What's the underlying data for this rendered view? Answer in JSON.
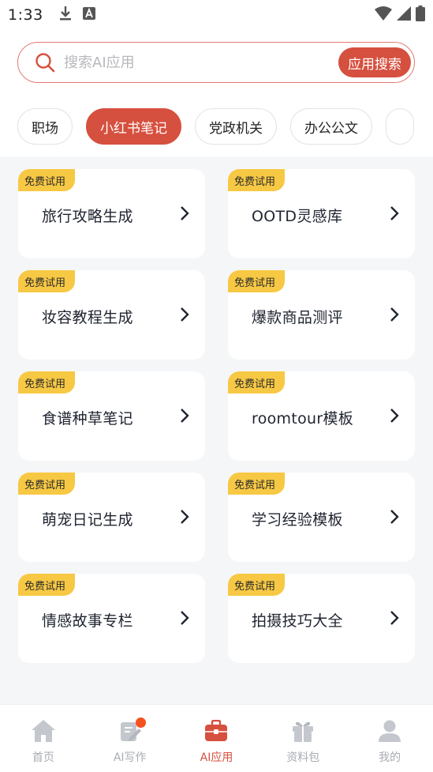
{
  "status_bar": {
    "time": "1:33"
  },
  "search": {
    "placeholder": "搜索AI应用",
    "button_label": "应用搜索"
  },
  "categories": [
    {
      "label": "职场",
      "active": false
    },
    {
      "label": "小红书笔记",
      "active": true
    },
    {
      "label": "党政机关",
      "active": false
    },
    {
      "label": "办公公文",
      "active": false
    }
  ],
  "cards": [
    {
      "badge": "免费试用",
      "title": "旅行攻略生成"
    },
    {
      "badge": "免费试用",
      "title": "OOTD灵感库"
    },
    {
      "badge": "免费试用",
      "title": "妆容教程生成"
    },
    {
      "badge": "免费试用",
      "title": "爆款商品测评"
    },
    {
      "badge": "免费试用",
      "title": "食谱种草笔记"
    },
    {
      "badge": "免费试用",
      "title": "roomtour模板"
    },
    {
      "badge": "免费试用",
      "title": "萌宠日记生成"
    },
    {
      "badge": "免费试用",
      "title": "学习经验模板"
    },
    {
      "badge": "免费试用",
      "title": "情感故事专栏"
    },
    {
      "badge": "免费试用",
      "title": "拍摄技巧大全"
    }
  ],
  "bottom_nav": [
    {
      "label": "首页",
      "icon": "home-icon",
      "active": false
    },
    {
      "label": "AI写作",
      "icon": "edit-icon",
      "active": false,
      "has_dot": true
    },
    {
      "label": "AI应用",
      "icon": "toolbox-icon",
      "active": true
    },
    {
      "label": "资料包",
      "icon": "gift-icon",
      "active": false
    },
    {
      "label": "我的",
      "icon": "user-icon",
      "active": false
    }
  ],
  "colors": {
    "accent": "#d6503f",
    "badge": "#f7c844",
    "background": "#f5f6f8",
    "inactive_nav": "#a9acb3"
  }
}
